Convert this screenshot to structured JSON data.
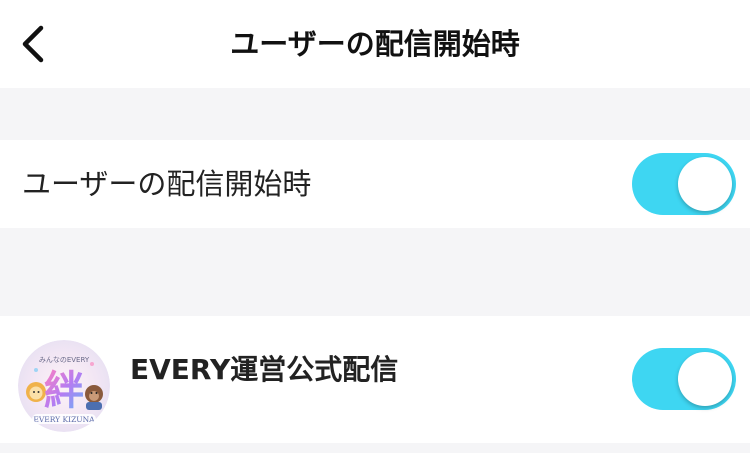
{
  "header": {
    "title": "ユーザーの配信開始時"
  },
  "settings": {
    "user_stream_start": {
      "label": "ユーザーの配信開始時",
      "enabled": true
    }
  },
  "channels": [
    {
      "name": "EVERY運営公式配信",
      "avatar_text": "絆",
      "avatar_caption": "EVERY KIZUNA",
      "enabled": true
    }
  ],
  "colors": {
    "toggle_on": "#3ed6f2",
    "section_background": "#f5f5f7"
  },
  "icons": {
    "back": "chevron-left-icon"
  }
}
